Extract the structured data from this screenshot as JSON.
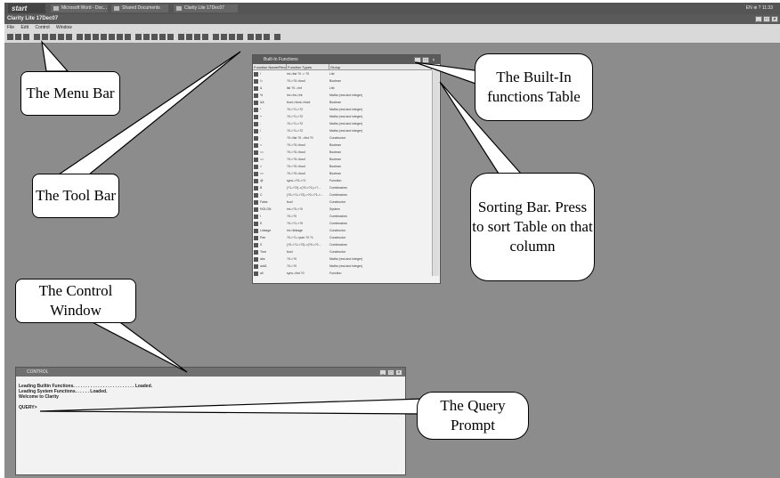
{
  "taskbar": {
    "start": "start",
    "buttons": [
      "Microsoft Word - Doc...",
      "Shared Documents",
      "Clarity Lite 17Dec07"
    ],
    "tray": "EN  ⊕ ? 11:33"
  },
  "window": {
    "title": "Clarity Lite 17Dec07",
    "menu": [
      "File",
      "Edit",
      "Control",
      "Window"
    ]
  },
  "builtins": {
    "title": "Built-In Functions",
    "columns": [
      "Function Name/Recency",
      "Function Types",
      "Group"
    ],
    "rows": [
      [
        "!",
        "int->list ?0 -> ?0",
        "List"
      ],
      [
        "!=",
        "?0->?0->bool",
        "Boolean"
      ],
      [
        "&",
        "list ?0 ->int",
        "List"
      ],
      [
        "%",
        "int->int->int",
        "Maths (real and integer)"
      ],
      [
        "&&",
        "bool->bool->bool",
        "Boolean"
      ],
      [
        "*",
        "?0->?1->?2",
        "Maths (real and integer)"
      ],
      [
        "+",
        "?0->?1->?2",
        "Maths (real and integer)"
      ],
      [
        "-",
        "?0->?1->?2",
        "Maths (real and integer)"
      ],
      [
        "/",
        "?0->?1->?2",
        "Maths (real and integer)"
      ],
      [
        ":",
        "?0->list ?0 ->list ?0",
        "Constructor"
      ],
      [
        "<",
        "?0->?0->bool",
        "Boolean"
      ],
      [
        "<=",
        "?0->?0->bool",
        "Boolean"
      ],
      [
        "==",
        "?0->?0->bool",
        "Boolean"
      ],
      [
        ">",
        "?0->?0->bool",
        "Boolean"
      ],
      [
        ">=",
        "?0->?0->bool",
        "Boolean"
      ],
      [
        "@",
        "sync->?0->?1",
        "Function"
      ],
      [
        "B",
        "(?1->?2)->(?0->?1)->?...",
        "Combinators"
      ],
      [
        "C",
        "(?0->?1->?2)->?0->?1->...",
        "Combinators"
      ],
      [
        "False",
        "bool",
        "Constructor"
      ],
      [
        "HOLON",
        "int->?0->?0",
        "System"
      ],
      [
        "I",
        "?0->?0",
        "Combinators"
      ],
      [
        "K",
        "?0->?1->?0",
        "Combinators"
      ],
      [
        "Linkage",
        "int->linkage",
        "Constructor"
      ],
      [
        "Pair",
        "?0->?1->pair ?0 ?1",
        "Constructor"
      ],
      [
        "S",
        "(?0->?1->?2)->(?0->?1...",
        "Combinators"
      ],
      [
        "True",
        "bool",
        "Constructor"
      ],
      [
        "abs",
        "?0->?0",
        "Maths (real and integer)"
      ],
      [
        "add1",
        "?0->?0",
        "Maths (real and integer)"
      ],
      [
        "all",
        "sync->list ?0",
        "Function"
      ]
    ]
  },
  "control": {
    "title": "CONTROL",
    "lines": [
      "Leading Builtin Functions. . . . . . . . . . . . . . . . . . . . . . . . . Loaded.",
      "Leading System Functions. . . . . . Loaded.",
      "Welcome to Clarity",
      "",
      "QUERY>"
    ]
  },
  "callouts": {
    "menu_bar": "The Menu Bar",
    "tool_bar": "The Tool Bar",
    "builtins_table": "The Built-In functions Table",
    "sorting_bar": "Sorting Bar. Press to sort Table on that column",
    "control_window": "The Control Window",
    "query_prompt": "The Query Prompt"
  }
}
